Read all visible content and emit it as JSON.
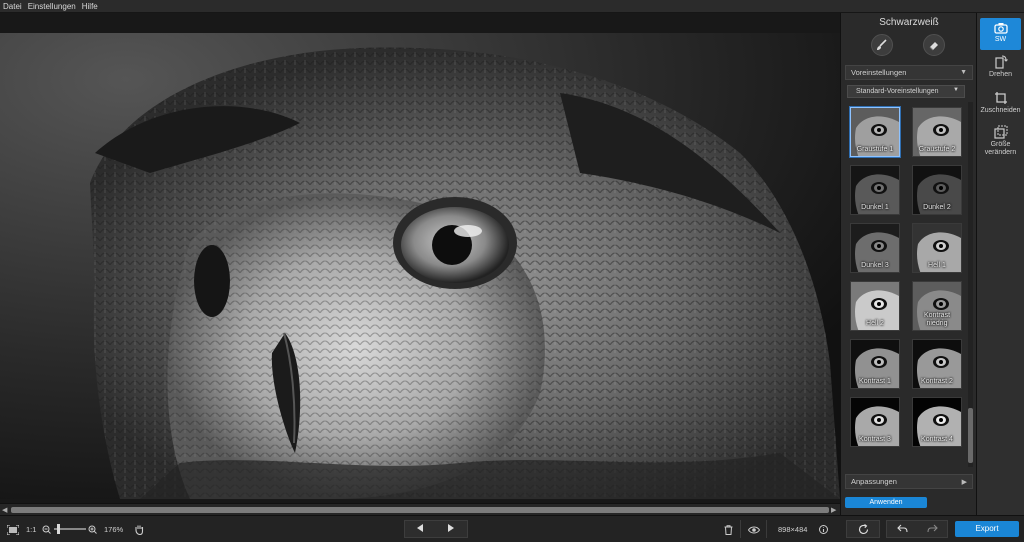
{
  "menu": {
    "items": [
      "Datei",
      "Einstellungen",
      "Hilfe"
    ]
  },
  "panel": {
    "title": "Schwarzweiß",
    "tools": [
      {
        "icon": "brush-icon"
      },
      {
        "icon": "eraser-icon"
      }
    ],
    "presets_section": "Voreinstellungen",
    "preset_dropdown": "Standard-Voreinstellungen",
    "presets": [
      {
        "label": "Graustufe 1",
        "selected": true
      },
      {
        "label": "Graustufe 2",
        "selected": false
      },
      {
        "label": "Dunkel 1",
        "selected": false
      },
      {
        "label": "Dunkel 2",
        "selected": false
      },
      {
        "label": "Dunkel 3",
        "selected": false
      },
      {
        "label": "Hell 1",
        "selected": false
      },
      {
        "label": "Hell 2",
        "selected": false
      },
      {
        "label": "Kontrast niedrig",
        "selected": false
      },
      {
        "label": "Kontrast 1",
        "selected": false
      },
      {
        "label": "Kontrast 2",
        "selected": false
      },
      {
        "label": "Kontrast 3",
        "selected": false
      },
      {
        "label": "Kontrast 4",
        "selected": false
      }
    ],
    "adjust_section": "Anpassungen",
    "apply_label": "Anwenden"
  },
  "strip": {
    "items": [
      {
        "label": "SW",
        "icon": "camera-icon",
        "active": true
      },
      {
        "label": "Drehen",
        "icon": "rotate-icon",
        "active": false
      },
      {
        "label": "Zuschneiden",
        "icon": "crop-icon",
        "active": false
      },
      {
        "label": "Größe verändern",
        "icon": "resize-icon",
        "active": false
      }
    ]
  },
  "bottom": {
    "fit_label": "1:1",
    "zoom": "176%",
    "dimensions": "898×484",
    "export_label": "Export"
  },
  "colors": {
    "accent": "#1a86d6",
    "selection": "#8fc3ff"
  }
}
